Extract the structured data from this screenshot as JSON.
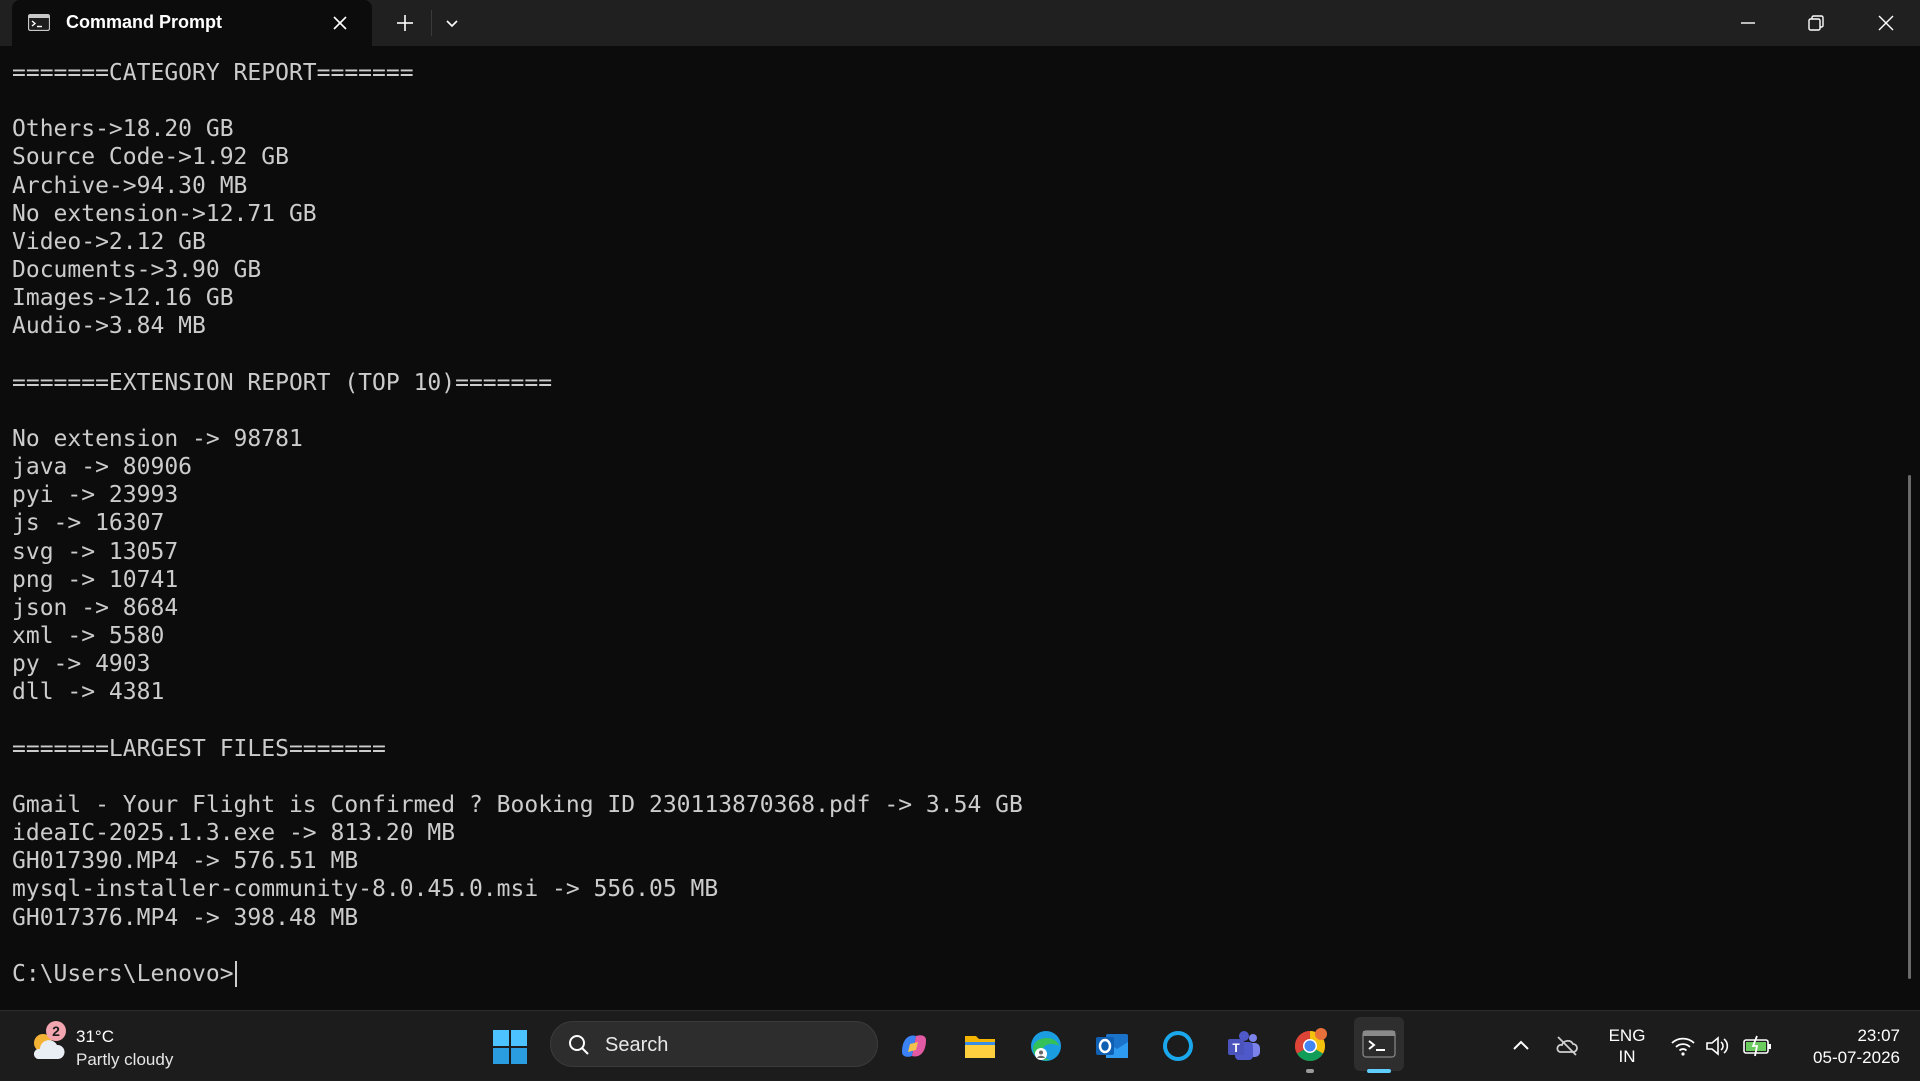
{
  "window": {
    "tab_title": "Command Prompt"
  },
  "terminal": {
    "lines": [
      "=======CATEGORY REPORT=======",
      "",
      "Others->18.20 GB",
      "Source Code->1.92 GB",
      "Archive->94.30 MB",
      "No extension->12.71 GB",
      "Video->2.12 GB",
      "Documents->3.90 GB",
      "Images->12.16 GB",
      "Audio->3.84 MB",
      "",
      "=======EXTENSION REPORT (TOP 10)=======",
      "",
      "No extension -> 98781",
      "java -> 80906",
      "pyi -> 23993",
      "js -> 16307",
      "svg -> 13057",
      "png -> 10741",
      "json -> 8684",
      "xml -> 5580",
      "py -> 4903",
      "dll -> 4381",
      "",
      "=======LARGEST FILES=======",
      "",
      "Gmail - Your Flight is Confirmed ? Booking ID 230113870368.pdf -> 3.54 GB",
      "ideaIC-2025.1.3.exe -> 813.20 MB",
      "GH017390.MP4 -> 576.51 MB",
      "mysql-installer-community-8.0.45.0.msi -> 556.05 MB",
      "GH017376.MP4 -> 398.48 MB",
      "",
      "C:\\Users\\Lenovo>"
    ]
  },
  "taskbar": {
    "weather": {
      "badge": "2",
      "temperature": "31°C",
      "condition": "Partly cloudy"
    },
    "search_label": "Search",
    "apps": [
      "copilot-icon",
      "file-explorer-icon",
      "edge-icon",
      "outlook-icon",
      "cortana-icon",
      "teams-icon",
      "chrome-icon",
      "terminal-icon"
    ],
    "language": {
      "line1": "ENG",
      "line2": "IN"
    },
    "clock": {
      "time": "23:07",
      "date": "05-07-2026"
    }
  },
  "colors": {
    "terminal_bg": "#0c0c0c",
    "terminal_fg": "#cccccc",
    "titlebar_bg": "#202020",
    "taskbar_bg": "#1c1c1c",
    "accent": "#60cdff"
  }
}
